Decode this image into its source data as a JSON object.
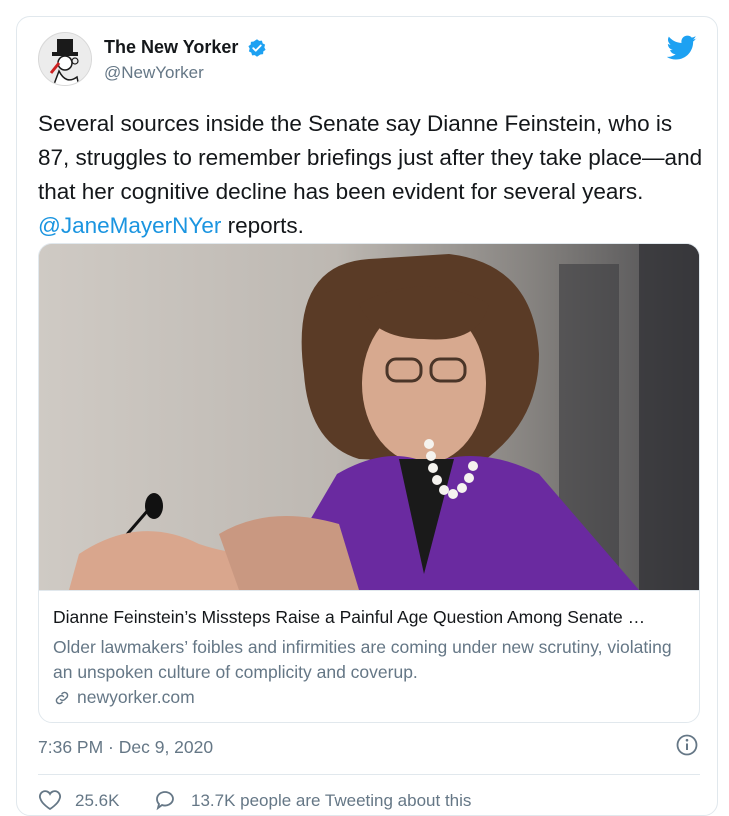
{
  "author": {
    "name": "The New Yorker",
    "handle": "@NewYorker"
  },
  "icons": {
    "verified": "verified-badge-icon",
    "bird": "twitter-bird-icon",
    "info": "info-icon",
    "link": "link-icon",
    "heart": "heart-icon",
    "reply": "speech-bubble-icon"
  },
  "colors": {
    "accent": "#1da1f2",
    "mention": "#1b95e0",
    "muted": "#657786"
  },
  "tweet": {
    "text_before": "Several sources inside the Senate say Dianne Feinstein, who is 87, struggles to remember briefings just after they take place—and that her cognitive decline has been evident for several years. ",
    "mention": "@JaneMayerNYer",
    "text_after": " reports."
  },
  "link_card": {
    "title": "Dianne Feinstein’s Missteps Raise a Painful Age Question Among Senate …",
    "description": "Older lawmakers’ foibles and infirmities are coming under new scrutiny, violating an unspoken culture of complicity and coverup.",
    "domain": "newyorker.com"
  },
  "meta": {
    "timestamp": "7:36 PM · Dec 9, 2020"
  },
  "stats": {
    "likes": "25.6K",
    "talking": "13.7K people are Tweeting about this"
  }
}
